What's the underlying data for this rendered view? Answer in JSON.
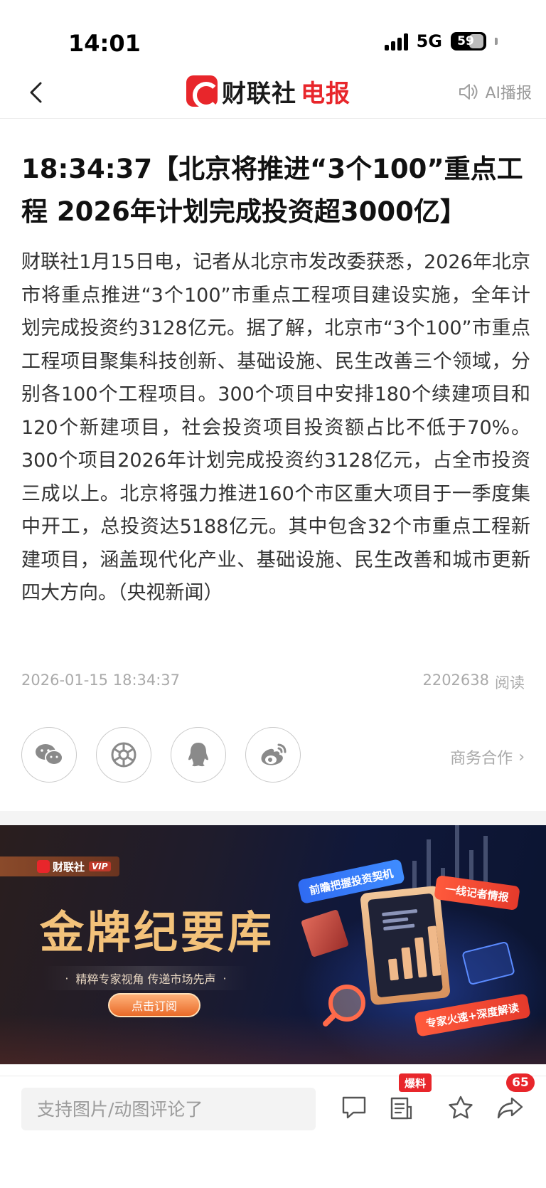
{
  "status_bar": {
    "time": "14:01",
    "network": "5G",
    "battery": "59"
  },
  "nav": {
    "brand_part1": "财联社",
    "brand_part2": "电报",
    "ai_label": "AI播报"
  },
  "article": {
    "headline": "18:34:37【北京将推进“3个100”重点工程 2026年计划完成投资超3000亿】",
    "body": "财联社1月15日电，记者从北京市发改委获悉，2026年北京市将重点推进“3个100”市重点工程项目建设实施，全年计划完成投资约3128亿元。据了解，北京市“3个100”市重点工程项目聚集科技创新、基础设施、民生改善三个领域，分别各100个工程项目。300个项目中安排180个续建项目和120个新建项目，社会投资项目投资额占比不低于70%。300个项目2026年计划完成投资约3128亿元，占全市投资三成以上。北京将强力推进160个市区重大项目于一季度集中开工，总投资达5188亿元。其中包含32个市重点工程新建项目，涵盖现代化产业、基础设施、民生改善和城市更新四大方向。（央视新闻）",
    "datetime": "2026-01-15 18:34:37",
    "reads": "2202638",
    "reads_label": "阅读"
  },
  "share": {
    "business_label": "商务合作",
    "business_arrow": "›"
  },
  "banner": {
    "vip_brand": "财联社",
    "vip_badge": "VIP",
    "title": "金牌纪要库",
    "subtitle_dot": "·",
    "subtitle": "精粹专家视角 传递市场先声",
    "cta": "点击订阅",
    "tag_blue": "前瞻把握投资契机",
    "tag_red1": "一线记者情报",
    "tag_red2": "专家火速+深度解读"
  },
  "bottom_bar": {
    "comment_placeholder": "支持图片/动图评论了",
    "tip_badge": "爆料",
    "share_count": "65"
  },
  "colors": {
    "brand_red": "#e8262b",
    "meta_gray": "#aaaaaa",
    "banner_gold": "#f3c27a"
  }
}
